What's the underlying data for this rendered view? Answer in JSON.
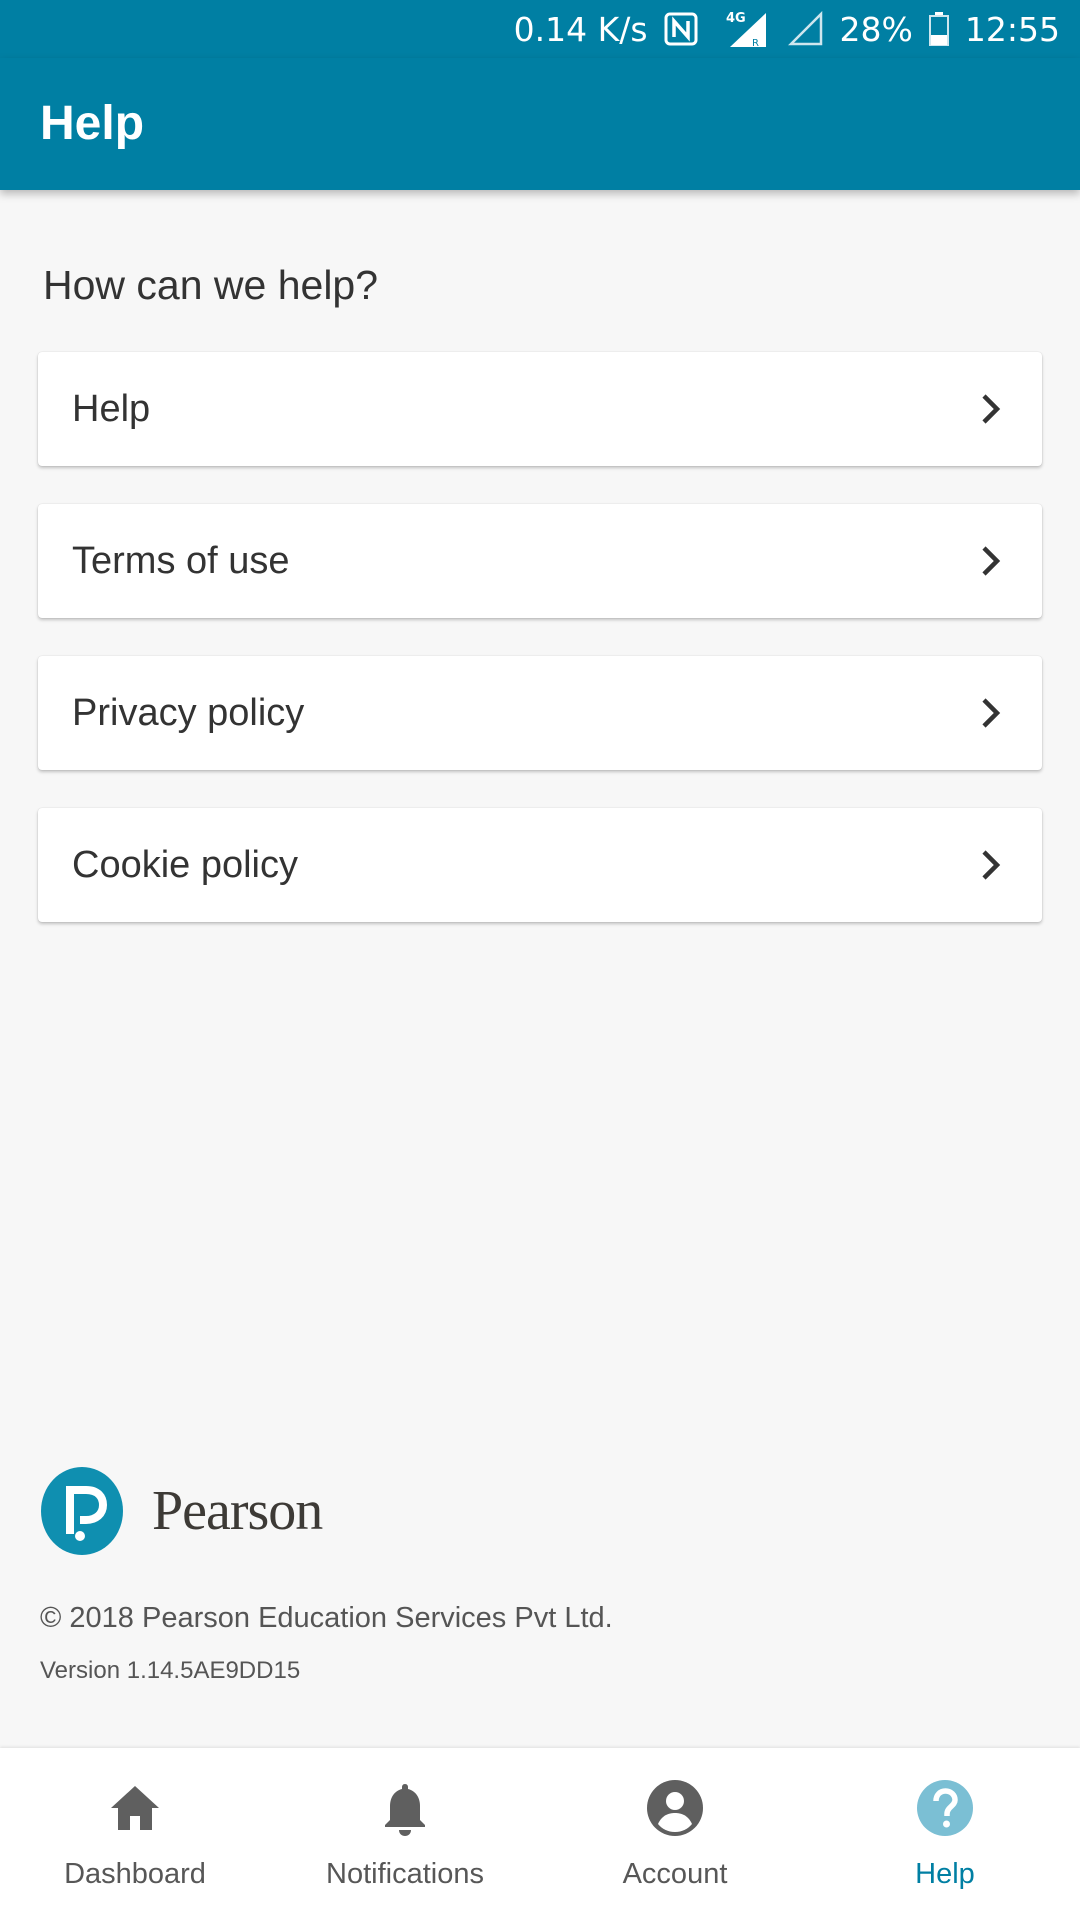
{
  "status_bar": {
    "network_speed": "0.14 K/s",
    "network_type": "4G",
    "battery": "28%",
    "time": "12:55"
  },
  "app_bar": {
    "title": "Help"
  },
  "section_heading": "How can we help?",
  "menu": [
    {
      "label": "Help"
    },
    {
      "label": "Terms of use"
    },
    {
      "label": "Privacy policy"
    },
    {
      "label": "Cookie policy"
    }
  ],
  "footer": {
    "brand_name": "Pearson",
    "copyright": "© 2018 Pearson Education Services Pvt Ltd.",
    "version": "Version 1.14.5AE9DD15"
  },
  "bottom_nav": {
    "items": [
      {
        "label": "Dashboard",
        "icon": "home-icon",
        "active": false
      },
      {
        "label": "Notifications",
        "icon": "bell-icon",
        "active": false
      },
      {
        "label": "Account",
        "icon": "account-icon",
        "active": false
      },
      {
        "label": "Help",
        "icon": "help-icon",
        "active": true
      }
    ]
  },
  "colors": {
    "primary": "#007fa3",
    "background": "#f7f7f7",
    "active_tab": "#007fa3",
    "inactive_tab": "#575757"
  }
}
